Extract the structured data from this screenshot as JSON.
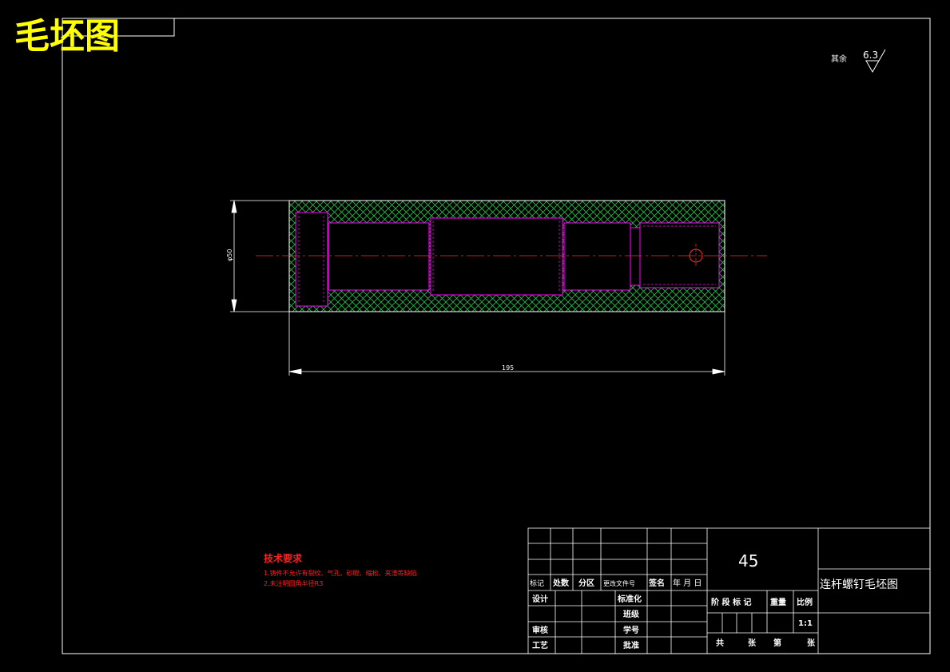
{
  "drawing": {
    "heading": "毛坯图",
    "surface_finish": {
      "label": "其余",
      "value": "6.3"
    },
    "dimension_diameter": "φ50",
    "dimension_length": "195"
  },
  "technical_requirements": {
    "title": "技术要求",
    "items": [
      "1.铸件不允许有裂纹、气孔、砂眼、缩松、夹渣等缺陷",
      "2.未注明圆角半径R3"
    ]
  },
  "title_block": {
    "material": "45",
    "part_name": "连杆螺钉毛坯图",
    "revision_headers": [
      "标记",
      "处数",
      "分区",
      "更改文件号",
      "签名",
      "年 月 日"
    ],
    "design_label": "设计",
    "standardization_label": "标准化",
    "class_label": "班级",
    "review_label": "审核",
    "student_id_label": "学号",
    "process_label": "工艺",
    "approval_label": "批准",
    "stage_mark_label": "阶 段 标 记",
    "weight_label": "重量",
    "ratio_label": "比例",
    "ratio_value": "1:1",
    "sheets_total_label": "共",
    "sheets_unit_label": "张",
    "sheet_no_label": "第",
    "sheet_unit2_label": "张"
  }
}
